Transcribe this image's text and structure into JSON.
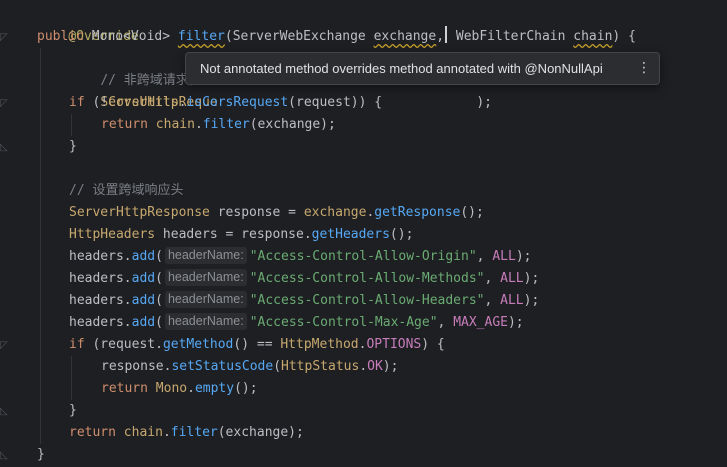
{
  "tooltip": {
    "message": "Not annotated method overrides method annotated with @NonNullApi",
    "more_icon": "vertical-ellipsis-icon"
  },
  "code": {
    "l1": {
      "annotation": "@Override"
    },
    "l2": {
      "kw_public": "public",
      "ret_type": "Mono<Void>",
      "method_name": "filter",
      "open": "(",
      "p1_type": "ServerWebExchange",
      "p1_name": "exchange",
      "comma": ",",
      "p2_type": "WebFilterChain",
      "p2_name": "chain",
      "close": ") {"
    },
    "l3": {
      "comment_visible": "// 非跨域请求，直"
    },
    "l4": {
      "type_visible": "ServerHttpReque",
      "tail_visible": ");"
    },
    "l5": {
      "kw_if": "if",
      "pre": " (!",
      "cls": "CorsUtils",
      "dot": ".",
      "method": "isCorsRequest",
      "post": "(request)) {"
    },
    "l6": {
      "kw_return": "return",
      "obj": "chain",
      "dot": ".",
      "method": "filter",
      "post": "(exchange);"
    },
    "l7": {
      "brace": "}"
    },
    "l9": {
      "comment": "// 设置跨域响应头"
    },
    "l10": {
      "type": "ServerHttpResponse",
      "mid": " response = ",
      "obj": "exchange",
      "dot": ".",
      "method": "getResponse",
      "post": "();"
    },
    "l11": {
      "type": "HttpHeaders",
      "mid": " headers = response",
      "dot": ".",
      "method": "getHeaders",
      "post": "();"
    },
    "header_lines": [
      {
        "obj": "headers",
        "dot": ".",
        "method": "add",
        "open": "(",
        "hint": "headerName:",
        "value": "\"Access-Control-Allow-Origin\"",
        "sep": ", ",
        "const": "ALL",
        "end": ");"
      },
      {
        "obj": "headers",
        "dot": ".",
        "method": "add",
        "open": "(",
        "hint": "headerName:",
        "value": "\"Access-Control-Allow-Methods\"",
        "sep": ", ",
        "const": "ALL",
        "end": ");"
      },
      {
        "obj": "headers",
        "dot": ".",
        "method": "add",
        "open": "(",
        "hint": "headerName:",
        "value": "\"Access-Control-Allow-Headers\"",
        "sep": ", ",
        "const": "ALL",
        "end": ");"
      },
      {
        "obj": "headers",
        "dot": ".",
        "method": "add",
        "open": "(",
        "hint": "headerName:",
        "value": "\"Access-Control-Max-Age\"",
        "sep": ", ",
        "const": "MAX_AGE",
        "end": ");"
      }
    ],
    "l16": {
      "kw_if": "if",
      "pre": " (request",
      "dot": ".",
      "method": "getMethod",
      "mid": "() == ",
      "cls": "HttpMethod",
      "dot2": ".",
      "const": "OPTIONS",
      "post": ") {"
    },
    "l17": {
      "obj": "response",
      "dot": ".",
      "method": "setStatusCode",
      "open": "(",
      "cls": "HttpStatus",
      "dot2": ".",
      "const": "OK",
      "post": ");"
    },
    "l18": {
      "kw_return": "return",
      "cls": "Mono",
      "dot": ".",
      "method": "empty",
      "post": "();"
    },
    "l19": {
      "brace": "}"
    },
    "l20": {
      "kw_return": "return",
      "obj": "chain",
      "dot": ".",
      "method": "filter",
      "post": "(exchange);"
    },
    "l21": {
      "brace": "}"
    }
  },
  "gutter_icons": [
    "fold-icon",
    "fold-icon",
    "fold-icon",
    "fold-icon",
    "fold-icon",
    "fold-icon",
    "fold-icon"
  ]
}
